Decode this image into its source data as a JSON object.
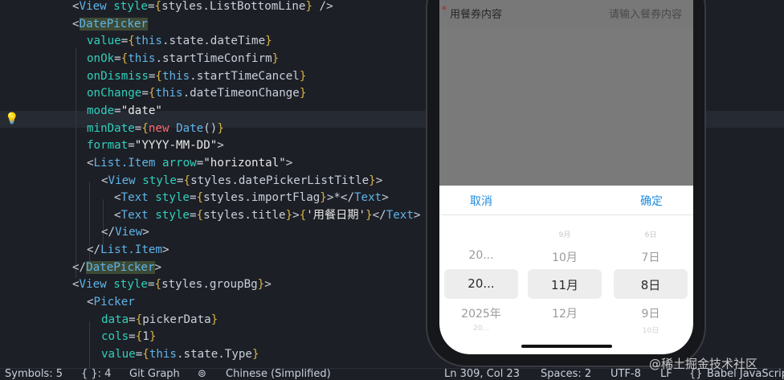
{
  "editor": {
    "lines": [
      {
        "tokens": [
          {
            "t": "p",
            "v": "<"
          },
          {
            "t": "t",
            "v": "View"
          },
          {
            "t": "p",
            "v": " "
          },
          {
            "t": "a",
            "v": "style"
          },
          {
            "t": "p",
            "v": "="
          },
          {
            "t": "b",
            "v": "{"
          },
          {
            "t": "v",
            "v": "styles"
          },
          {
            "t": "p",
            "v": "."
          },
          {
            "t": "f",
            "v": "ListBottomLine"
          },
          {
            "t": "b",
            "v": "}"
          },
          {
            "t": "p",
            "v": " />"
          }
        ]
      },
      {
        "tokens": [
          {
            "t": "p",
            "v": "<"
          },
          {
            "t": "t",
            "v": "DatePicker",
            "hl": true
          }
        ]
      },
      {
        "tokens": [
          {
            "t": "a",
            "v": "value"
          },
          {
            "t": "p",
            "v": "="
          },
          {
            "t": "b",
            "v": "{"
          },
          {
            "t": "c",
            "v": "this"
          },
          {
            "t": "p",
            "v": "."
          },
          {
            "t": "f",
            "v": "state"
          },
          {
            "t": "p",
            "v": "."
          },
          {
            "t": "f",
            "v": "dateTime"
          },
          {
            "t": "b",
            "v": "}"
          }
        ]
      },
      {
        "tokens": [
          {
            "t": "a",
            "v": "onOk"
          },
          {
            "t": "p",
            "v": "="
          },
          {
            "t": "b",
            "v": "{"
          },
          {
            "t": "c",
            "v": "this"
          },
          {
            "t": "p",
            "v": "."
          },
          {
            "t": "f",
            "v": "startTimeConfirm"
          },
          {
            "t": "b",
            "v": "}"
          }
        ]
      },
      {
        "tokens": [
          {
            "t": "a",
            "v": "onDismiss"
          },
          {
            "t": "p",
            "v": "="
          },
          {
            "t": "b",
            "v": "{"
          },
          {
            "t": "c",
            "v": "this"
          },
          {
            "t": "p",
            "v": "."
          },
          {
            "t": "f",
            "v": "startTimeCancel"
          },
          {
            "t": "b",
            "v": "}"
          }
        ]
      },
      {
        "tokens": [
          {
            "t": "a",
            "v": "onChange"
          },
          {
            "t": "p",
            "v": "="
          },
          {
            "t": "b",
            "v": "{"
          },
          {
            "t": "c",
            "v": "this"
          },
          {
            "t": "p",
            "v": "."
          },
          {
            "t": "f",
            "v": "dateTimeonChange"
          },
          {
            "t": "b",
            "v": "}"
          }
        ]
      },
      {
        "tokens": [
          {
            "t": "a",
            "v": "mode"
          },
          {
            "t": "p",
            "v": "="
          },
          {
            "t": "s",
            "v": "\"date\""
          }
        ]
      },
      {
        "tokens": [
          {
            "t": "a",
            "v": "minDate"
          },
          {
            "t": "p",
            "v": "="
          },
          {
            "t": "b",
            "v": "{"
          },
          {
            "t": "k",
            "v": "new"
          },
          {
            "t": "p",
            "v": " "
          },
          {
            "t": "t",
            "v": "Date"
          },
          {
            "t": "p",
            "v": "()"
          },
          {
            "t": "b",
            "v": "}"
          }
        ]
      },
      {
        "tokens": [
          {
            "t": "a",
            "v": "format"
          },
          {
            "t": "p",
            "v": "="
          },
          {
            "t": "s",
            "v": "\"YYYY-MM-DD\""
          },
          {
            "t": "p",
            "v": ">"
          }
        ]
      },
      {
        "tokens": [
          {
            "t": "p",
            "v": "<"
          },
          {
            "t": "t",
            "v": "List.Item"
          },
          {
            "t": "p",
            "v": " "
          },
          {
            "t": "a",
            "v": "arrow"
          },
          {
            "t": "p",
            "v": "="
          },
          {
            "t": "s",
            "v": "\"horizontal\""
          },
          {
            "t": "p",
            "v": ">"
          }
        ]
      },
      {
        "tokens": [
          {
            "t": "p",
            "v": "<"
          },
          {
            "t": "t",
            "v": "View"
          },
          {
            "t": "p",
            "v": " "
          },
          {
            "t": "a",
            "v": "style"
          },
          {
            "t": "p",
            "v": "="
          },
          {
            "t": "b",
            "v": "{"
          },
          {
            "t": "v",
            "v": "styles"
          },
          {
            "t": "p",
            "v": "."
          },
          {
            "t": "f",
            "v": "datePickerListTitle"
          },
          {
            "t": "b",
            "v": "}"
          },
          {
            "t": "p",
            "v": ">"
          }
        ]
      },
      {
        "tokens": [
          {
            "t": "p",
            "v": "<"
          },
          {
            "t": "t",
            "v": "Text"
          },
          {
            "t": "p",
            "v": " "
          },
          {
            "t": "a",
            "v": "style"
          },
          {
            "t": "p",
            "v": "="
          },
          {
            "t": "b",
            "v": "{"
          },
          {
            "t": "v",
            "v": "styles"
          },
          {
            "t": "p",
            "v": "."
          },
          {
            "t": "f",
            "v": "importFlag"
          },
          {
            "t": "b",
            "v": "}"
          },
          {
            "t": "p",
            "v": ">*</"
          },
          {
            "t": "t",
            "v": "Text"
          },
          {
            "t": "p",
            "v": ">"
          }
        ]
      },
      {
        "tokens": [
          {
            "t": "p",
            "v": "<"
          },
          {
            "t": "t",
            "v": "Text"
          },
          {
            "t": "p",
            "v": " "
          },
          {
            "t": "a",
            "v": "style"
          },
          {
            "t": "p",
            "v": "="
          },
          {
            "t": "b",
            "v": "{"
          },
          {
            "t": "v",
            "v": "styles"
          },
          {
            "t": "p",
            "v": "."
          },
          {
            "t": "f",
            "v": "title"
          },
          {
            "t": "b",
            "v": "}"
          },
          {
            "t": "p",
            "v": ">"
          },
          {
            "t": "b",
            "v": "{"
          },
          {
            "t": "s",
            "v": "'用餐日期'"
          },
          {
            "t": "b",
            "v": "}"
          },
          {
            "t": "p",
            "v": "</"
          },
          {
            "t": "t",
            "v": "Text"
          },
          {
            "t": "p",
            "v": ">"
          }
        ]
      },
      {
        "tokens": [
          {
            "t": "p",
            "v": "</"
          },
          {
            "t": "t",
            "v": "View"
          },
          {
            "t": "p",
            "v": ">"
          }
        ]
      },
      {
        "tokens": [
          {
            "t": "p",
            "v": "</"
          },
          {
            "t": "t",
            "v": "List.Item"
          },
          {
            "t": "p",
            "v": ">"
          }
        ]
      },
      {
        "tokens": [
          {
            "t": "p",
            "v": "</"
          },
          {
            "t": "t",
            "v": "DatePicker",
            "hl": true
          },
          {
            "t": "p",
            "v": ">"
          }
        ]
      },
      {
        "tokens": [
          {
            "t": "p",
            "v": "<"
          },
          {
            "t": "t",
            "v": "View"
          },
          {
            "t": "p",
            "v": " "
          },
          {
            "t": "a",
            "v": "style"
          },
          {
            "t": "p",
            "v": "="
          },
          {
            "t": "b",
            "v": "{"
          },
          {
            "t": "v",
            "v": "styles"
          },
          {
            "t": "p",
            "v": "."
          },
          {
            "t": "f",
            "v": "groupBg"
          },
          {
            "t": "b",
            "v": "}"
          },
          {
            "t": "p",
            "v": ">"
          }
        ]
      },
      {
        "tokens": [
          {
            "t": "p",
            "v": "<"
          },
          {
            "t": "t",
            "v": "Picker"
          }
        ]
      },
      {
        "tokens": [
          {
            "t": "a",
            "v": "data"
          },
          {
            "t": "p",
            "v": "="
          },
          {
            "t": "b",
            "v": "{"
          },
          {
            "t": "v",
            "v": "pickerData"
          },
          {
            "t": "b",
            "v": "}"
          }
        ]
      },
      {
        "tokens": [
          {
            "t": "a",
            "v": "cols"
          },
          {
            "t": "p",
            "v": "="
          },
          {
            "t": "b",
            "v": "{"
          },
          {
            "t": "v",
            "v": "1"
          },
          {
            "t": "b",
            "v": "}"
          }
        ]
      },
      {
        "tokens": [
          {
            "t": "a",
            "v": "value"
          },
          {
            "t": "p",
            "v": "="
          },
          {
            "t": "b",
            "v": "{"
          },
          {
            "t": "c",
            "v": "this"
          },
          {
            "t": "p",
            "v": "."
          },
          {
            "t": "f",
            "v": "state"
          },
          {
            "t": "p",
            "v": "."
          },
          {
            "t": "f",
            "v": "Type"
          },
          {
            "t": "b",
            "v": "}"
          }
        ]
      }
    ]
  },
  "status_bar": {
    "symbols": "Symbols: 5",
    "braces": "{ }: 4",
    "git_graph": "Git Graph",
    "language_pack": "Chinese (Simplified)",
    "cursor": "Ln 309, Col 23",
    "spaces": "Spaces: 2",
    "encoding": "UTF-8",
    "eol": "LF",
    "language_mode": "Babel JavaScript"
  },
  "phone": {
    "form": {
      "required_mark": "*",
      "label": "用餐券内容",
      "placeholder": "请输入餐券内容"
    },
    "date_picker": {
      "cancel_label": "取消",
      "ok_label": "确定",
      "columns": [
        {
          "name": "year",
          "items": [
            "",
            "20...",
            "20...",
            "2025年",
            "20..."
          ],
          "selected_index": 2
        },
        {
          "name": "month",
          "items": [
            "9月",
            "10月",
            "11月",
            "12月",
            ""
          ],
          "selected_index": 2
        },
        {
          "name": "day",
          "items": [
            "6日",
            "7日",
            "8日",
            "9日",
            "10日"
          ],
          "selected_index": 2
        }
      ]
    }
  },
  "watermark": "@稀土掘金技术社区",
  "colors": {
    "editor_bg": "#1d1f26",
    "tag": "#5fb4e8",
    "attribute": "#2fd0bc",
    "brace": "#d6b44a",
    "picker_button": "#1e8be0"
  }
}
